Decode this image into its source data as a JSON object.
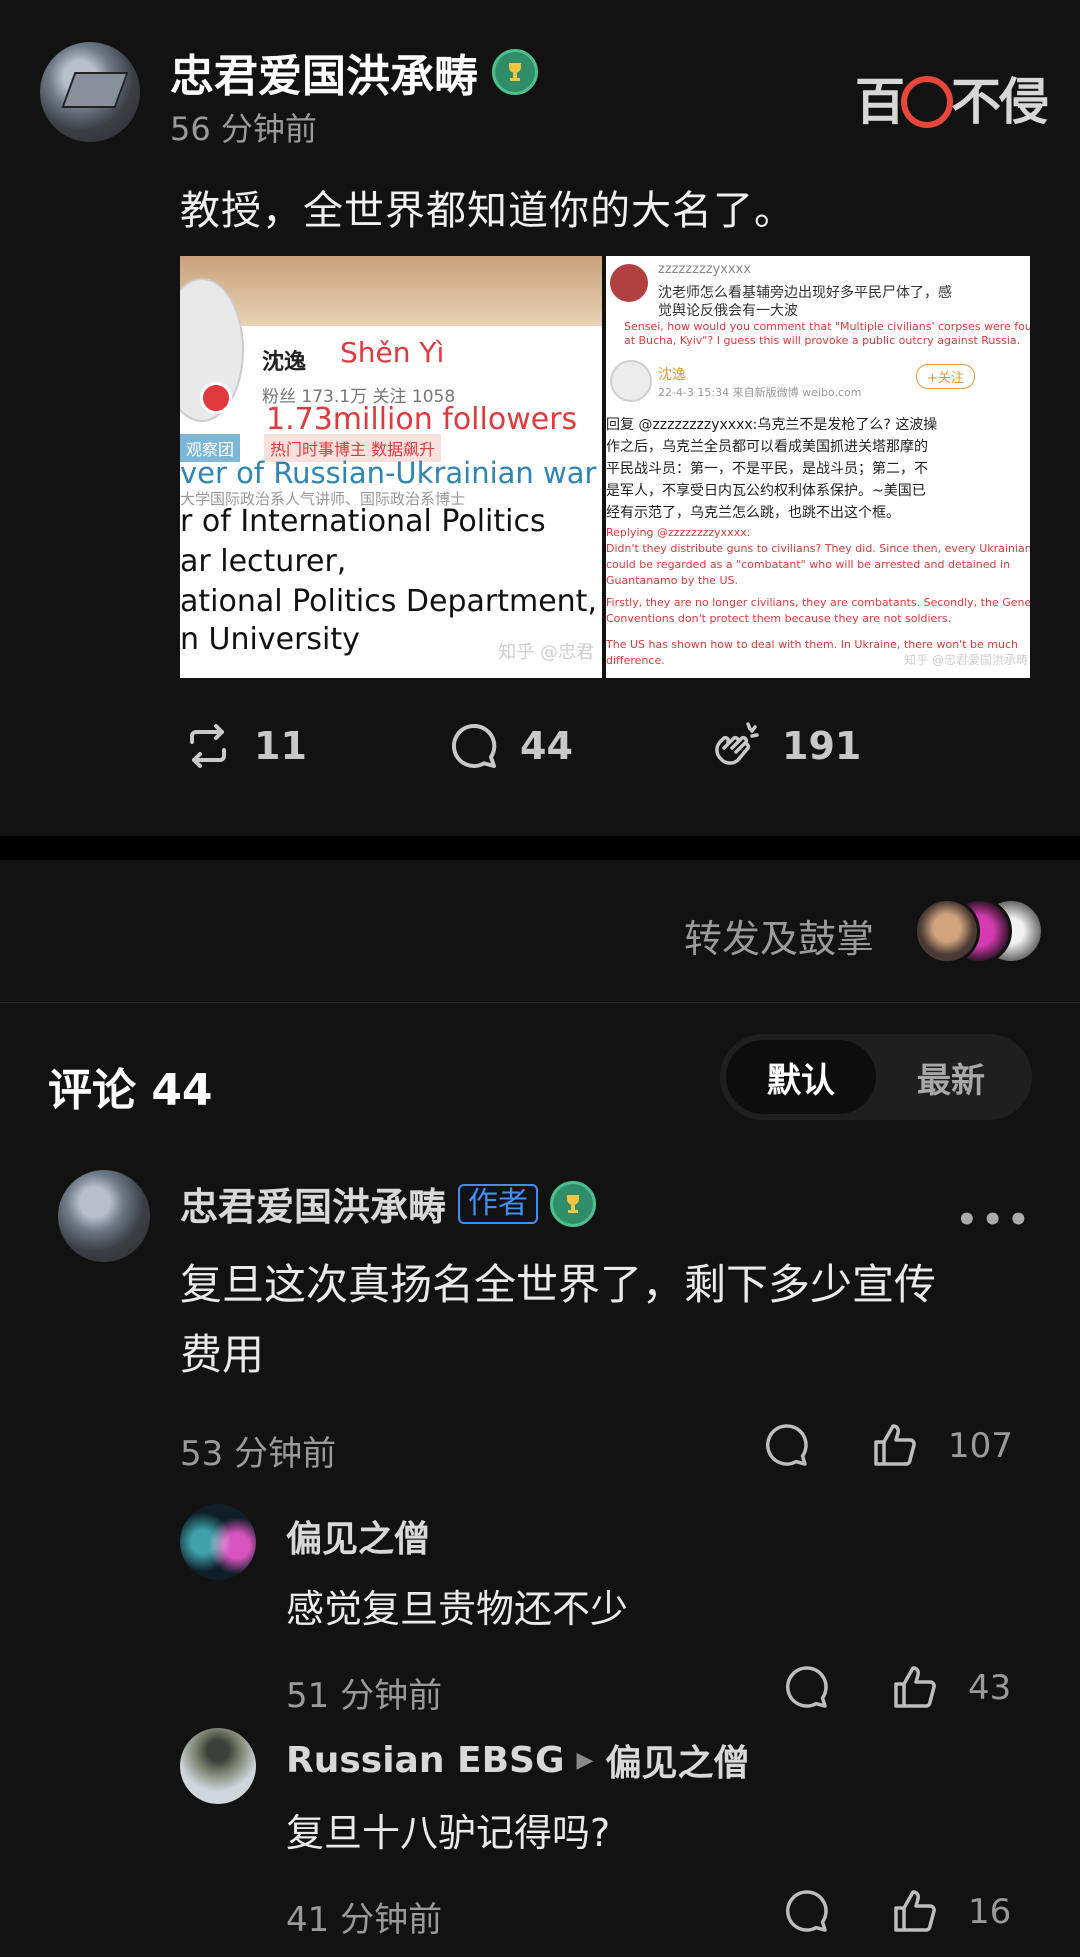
{
  "post": {
    "author": "忠君爱国洪承畴",
    "time": "56 分钟前",
    "watermark": "百⊘不侵",
    "text": "教授，全世界都知道你的大名了。",
    "image_left": {
      "name": "沈逸",
      "pinyin": "Shěn Yì",
      "stats": "粉丝 173.1万    关注 1058",
      "followers": "1.73million followers",
      "tag1": "观察团",
      "tag2": "热门时事博主 数据飙升",
      "observer": "ver of Russian-Ukrainian war",
      "sub": "大学国际政治系人气讲师、国际政治系博士",
      "line1": "r of International Politics",
      "line2": "ar lecturer,",
      "line3": "ational Politics Department,",
      "line4": "n University",
      "watermark": "知乎 @忠君"
    },
    "image_right": {
      "username": "zzzzzzzzyxxxx",
      "q1": "沈老师怎么看基辅旁边出现好多平民尸体了，感",
      "q2": "觉舆论反俄会有一大波",
      "qe1": "Sensei, how would you comment that \"Multiple civilians' corpses were found",
      "qe2": "at Bucha, Kyiv\"? I guess this will provoke a public outcry against Russia.",
      "name": "沈逸",
      "date": "22-4-3 15:34  来自新版微博 weibo.com",
      "follow": "+关注",
      "r1": "回复 @zzzzzzzzyxxxx:乌克兰不是发枪了么? 这波操",
      "r2": "作之后，乌克兰全员都可以看成美国抓进关塔那摩的",
      "r3": "平民战斗员：第一，不是平民，是战斗员；第二，不",
      "r4": "是军人，不享受日内瓦公约权利体系保护。~美国已",
      "r5": "经有示范了，乌克兰怎么跳，也跳不出这个框。",
      "re1": "Replying @zzzzzzzzyxxxx:",
      "re2": "Didn't they distribute guns to civilians? They did. Since then, every Ukrainian",
      "re3": "could be regarded as a \"combatant\" who will be arrested and detained in",
      "re4": "Guantanamo by the US.",
      "re5": "Firstly, they are no longer civilians, they are combatants. Secondly, the Geneva",
      "re6": "Conventions don't protect them because they are not soldiers.",
      "re7": "The US has shown how to deal with them. In Ukraine, there won't be much",
      "re8": "difference.",
      "watermark": "知乎 @忠君爱国洪承畴"
    },
    "actions": {
      "repost": "11",
      "comment": "44",
      "clap": "191"
    }
  },
  "repost_summary": {
    "label": "转发及鼓掌"
  },
  "comments": {
    "title": "评论 44",
    "sort_default": "默认",
    "sort_latest": "最新",
    "items": [
      {
        "author": "忠君爱国洪承畴",
        "tag": "作者",
        "body_line1": "复旦这次真扬名全世界了，剩下多少宣传",
        "body_line2": "费用",
        "time": "53 分钟前",
        "likes": "107",
        "more": "•••"
      },
      {
        "author": "偏见之僧",
        "body": "感觉复旦贵物还不少",
        "time": "51 分钟前",
        "likes": "43"
      },
      {
        "author": "Russian EBSG",
        "reply_to": "偏见之僧",
        "body": "复旦十八驴记得吗?",
        "time": "41 分钟前",
        "likes": "16"
      }
    ]
  },
  "colors": {
    "background": "#121212",
    "author_tag": "#3f8ff5",
    "badge": "#2f8d6a",
    "accent_red": "#e0393e"
  }
}
